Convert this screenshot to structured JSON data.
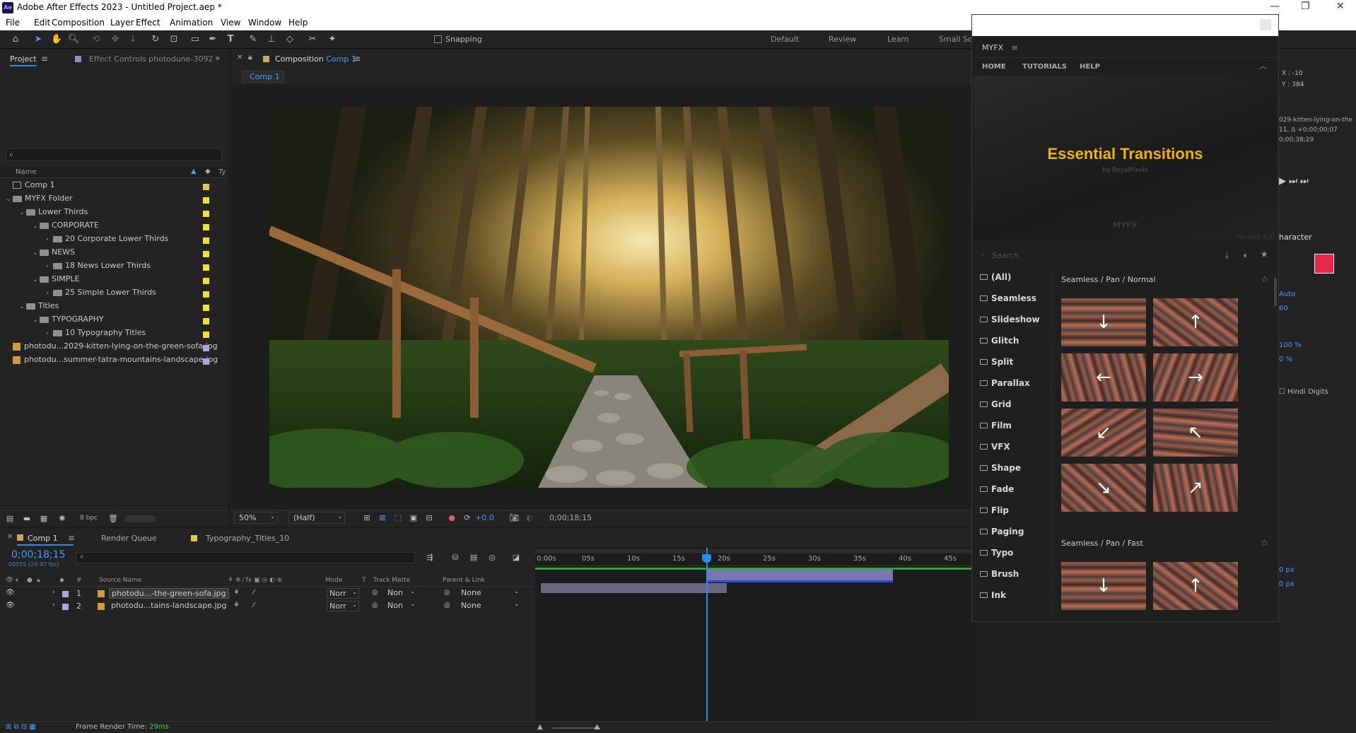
{
  "window": {
    "title": "Adobe After Effects 2023 - Untitled Project.aep *",
    "app_badge": "Ae"
  },
  "menu": [
    "File",
    "Edit",
    "Composition",
    "Layer",
    "Effect",
    "Animation",
    "View",
    "Window",
    "Help"
  ],
  "toolbar": {
    "snapping": "Snapping",
    "workspaces": [
      "Default",
      "Review",
      "Learn",
      "Small Scr"
    ]
  },
  "project": {
    "tab": "Project",
    "effect_tab": "Effect Controls photodune-3092",
    "search_placeholder": "",
    "col_name": "Name",
    "col_type": "Ty",
    "items": [
      {
        "label": "Comp 1",
        "indent": 0,
        "kind": "comp",
        "color": "#e0c84a"
      },
      {
        "label": "MYFX Folder",
        "indent": 0,
        "kind": "folder",
        "open": true,
        "color": "#f0e030"
      },
      {
        "label": "Lower Thirds",
        "indent": 1,
        "kind": "folder",
        "open": true,
        "color": "#f0e030"
      },
      {
        "label": "CORPORATE",
        "indent": 2,
        "kind": "folder",
        "open": true,
        "color": "#f0e030"
      },
      {
        "label": "20 Corporate Lower Thirds",
        "indent": 3,
        "kind": "folder",
        "open": false,
        "color": "#f0e030"
      },
      {
        "label": "NEWS",
        "indent": 2,
        "kind": "folder",
        "open": true,
        "color": "#f0e030"
      },
      {
        "label": "18 News Lower Thirds",
        "indent": 3,
        "kind": "folder",
        "open": false,
        "color": "#f0e030"
      },
      {
        "label": "SIMPLE",
        "indent": 2,
        "kind": "folder",
        "open": true,
        "color": "#f0e030"
      },
      {
        "label": "25 Simple Lower Thirds",
        "indent": 3,
        "kind": "folder",
        "open": false,
        "color": "#f0e030"
      },
      {
        "label": "Titles",
        "indent": 1,
        "kind": "folder",
        "open": true,
        "color": "#f0e030"
      },
      {
        "label": "TYPOGRAPHY",
        "indent": 2,
        "kind": "folder",
        "open": true,
        "color": "#f0e030"
      },
      {
        "label": "10 Typography Titles",
        "indent": 3,
        "kind": "folder",
        "open": false,
        "color": "#f0e030"
      },
      {
        "label": "photodu...2029-kitten-lying-on-the-green-sofa.jpg",
        "indent": 0,
        "kind": "image",
        "color": "#a8a8e0"
      },
      {
        "label": "photodu...summer-tatra-mountains-landscape.jpg",
        "indent": 0,
        "kind": "image",
        "color": "#a8a8e0"
      }
    ],
    "bpc": "8 bpc"
  },
  "composition": {
    "tab_prefix": "Composition",
    "tab_name": "Comp 1",
    "subtab": "Comp 1",
    "zoom": "50%",
    "resolution": "(Half)",
    "exposure": "+0.0",
    "timecode": "0;00;18;15"
  },
  "timeline": {
    "tab": "Comp 1",
    "render_queue": "Render Queue",
    "typo_tab": "Typography_Titles_10",
    "timecode": "0;00;18;15",
    "frame_info": "00555 (29.97 fps)",
    "cols": {
      "num": "#",
      "source": "Source Name",
      "mode": "Mode",
      "t": "T",
      "track": "Track Matte",
      "parent": "Parent & Link"
    },
    "layers": [
      {
        "num": "1",
        "name": "photodu...-the-green-sofa.jpg",
        "mode": "Norr",
        "matte": "Non",
        "parent": "None"
      },
      {
        "num": "2",
        "name": "photodu...tains-landscape.jpg",
        "mode": "Norr",
        "matte": "Non",
        "parent": "None"
      }
    ],
    "ruler": [
      "0:00s",
      "05s",
      "10s",
      "15s",
      "20s",
      "25s",
      "30s",
      "35s",
      "40s",
      "45s"
    ],
    "render_time_label": "Frame Render Time:",
    "render_time": "29ms"
  },
  "myfx": {
    "title": "MYFX",
    "nav": [
      "HOME",
      "TUTORIALS",
      "HELP"
    ],
    "banner_title": "Essential Transitions",
    "banner_sub": "by RoyalPixels",
    "banner_brand": "MYFX",
    "version": "Version 3.0",
    "search_placeholder": "Search",
    "categories": [
      "(All)",
      "Seamless",
      "Slideshow",
      "Glitch",
      "Split",
      "Parallax",
      "Grid",
      "Film",
      "VFX",
      "Shape",
      "Fade",
      "Flip",
      "Paging",
      "Typo",
      "Brush",
      "Ink"
    ],
    "section1": "Seamless / Pan / Normal",
    "section2": "Seamless / Pan / Fast",
    "arrows1": [
      "↓",
      "↑",
      "←",
      "→",
      "↙",
      "↖",
      "↘",
      "↗"
    ],
    "arrows2": [
      "↓",
      "↑"
    ]
  },
  "right_panel": {
    "x": "X : -10",
    "y": "Y : 384",
    "file": "029-kitten-lying-on-the",
    "delta": "11, Δ +0;00;00;07",
    "dur": "0;00;38;29",
    "character": "haracter",
    "auto": "Auto",
    "sixty": "60",
    "pct1": "100 %",
    "pct2": "0 %",
    "hindi": "Hindi Digits",
    "px1": "0 px",
    "px2": "0 px",
    "accent_color": "#e8254a"
  }
}
